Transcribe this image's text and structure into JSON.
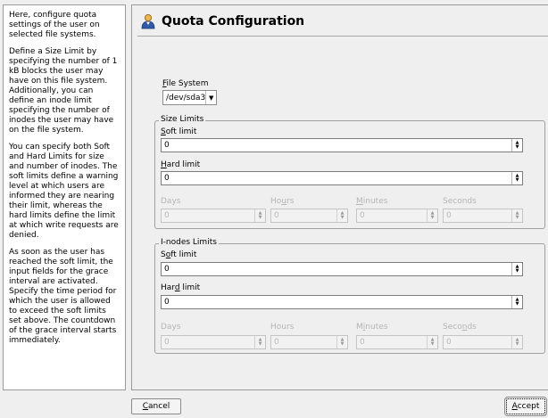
{
  "help": {
    "paragraphs": [
      "Here, configure quota settings of the user on selected file systems.",
      "Define a Size Limit by specifying the number of 1 kB blocks the user may have on this file system. Additionally, you can define an inode limit specifying the number of inodes the user may have on the file system.",
      "You can specify both Soft and Hard Limits for size and number of inodes. The soft limits define a warning level at which users are informed they are nearing their limit, whereas the hard limits define the limit at which write requests are denied.",
      "As soon as the user has reached the soft limit, the input fields for the grace interval are activated. Specify the time period for which the user is allowed to exceed the soft limits set above. The countdown of the grace interval starts immediately."
    ]
  },
  "header": {
    "title": "Quota Configuration",
    "icon": "user-quota-icon"
  },
  "file_system": {
    "label_mnemonic": "F",
    "label_rest": "ile System",
    "selected": "/dev/sda3"
  },
  "size_limits": {
    "title": "Size Limits",
    "soft": {
      "mn": "S",
      "rest": "oft limit",
      "value": "0"
    },
    "hard": {
      "mn": "H",
      "rest": "ard limit",
      "value": "0"
    },
    "grace": {
      "days": {
        "pre": "",
        "mn": "",
        "post": "Days",
        "value": "0"
      },
      "hours": {
        "pre": "Ho",
        "mn": "u",
        "post": "rs",
        "value": "0"
      },
      "minutes": {
        "pre": "",
        "mn": "M",
        "post": "inutes",
        "value": "0"
      },
      "seconds": {
        "pre": "",
        "mn": "",
        "post": "Seconds",
        "value": "0"
      }
    }
  },
  "inode_limits": {
    "title": "I-nodes Limits",
    "soft": {
      "pre": "S",
      "mn": "o",
      "rest": "ft limit",
      "value": "0"
    },
    "hard": {
      "pre": "Har",
      "mn": "d",
      "rest": " limit",
      "value": "0"
    },
    "grace": {
      "days": {
        "pre": "",
        "mn": "",
        "post": "Days",
        "value": "0"
      },
      "hours": {
        "pre": "Hours",
        "mn": "",
        "post": "",
        "value": "0"
      },
      "minutes": {
        "pre": "M",
        "mn": "i",
        "post": "nutes",
        "value": "0"
      },
      "seconds": {
        "pre": "Seco",
        "mn": "n",
        "post": "ds",
        "value": "0"
      }
    }
  },
  "buttons": {
    "cancel": {
      "mn": "C",
      "rest": "ancel"
    },
    "accept": {
      "mn": "A",
      "rest": "ccept"
    }
  }
}
